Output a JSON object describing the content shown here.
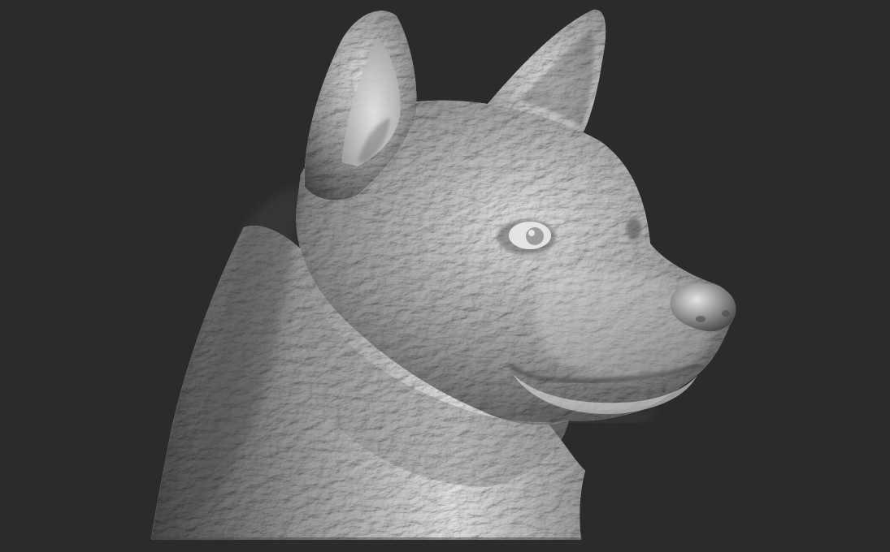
{
  "scene": {
    "subject": "dog-head-sculpt",
    "background_color": "#2b2b2b",
    "clay_base_color": "#9c9c9c",
    "clay_highlight_color": "#e4e4e4",
    "clay_shadow_color": "#4a4a4a"
  }
}
